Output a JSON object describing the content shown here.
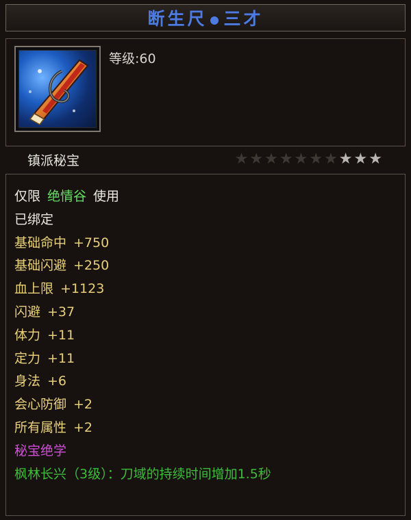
{
  "title": {
    "name": "断生尺",
    "suffix": "三才",
    "color": "#4e7be0"
  },
  "item_icon": {
    "name": "ruler-weapon-icon"
  },
  "level_text": "等级:60",
  "category": "镇派秘宝",
  "stars": {
    "total": 10,
    "filled": 3
  },
  "restriction": {
    "prefix": "仅限",
    "sect": "绝情谷",
    "suffix": "使用"
  },
  "bound": "已绑定",
  "attributes": [
    {
      "name": "基础命中",
      "value": "+750"
    },
    {
      "name": "基础闪避",
      "value": "+250"
    },
    {
      "name": "血上限",
      "value": "+1123"
    },
    {
      "name": "闪避",
      "value": "+37"
    },
    {
      "name": "体力",
      "value": "+11"
    },
    {
      "name": "定力",
      "value": "+11"
    },
    {
      "name": "身法",
      "value": "+6"
    },
    {
      "name": "会心防御",
      "value": "+2"
    },
    {
      "name": "所有属性",
      "value": "+2"
    }
  ],
  "skill_header": "秘宝绝学",
  "skill_line": "枫林长兴（3级）：刀域的持续时间增加1.5秒",
  "colors": {
    "bound": "#ede9e2",
    "sect": "#63e05f",
    "attr": "#e8d07a",
    "skill_header": "#d04ed8",
    "skill": "#3ebc3b"
  }
}
